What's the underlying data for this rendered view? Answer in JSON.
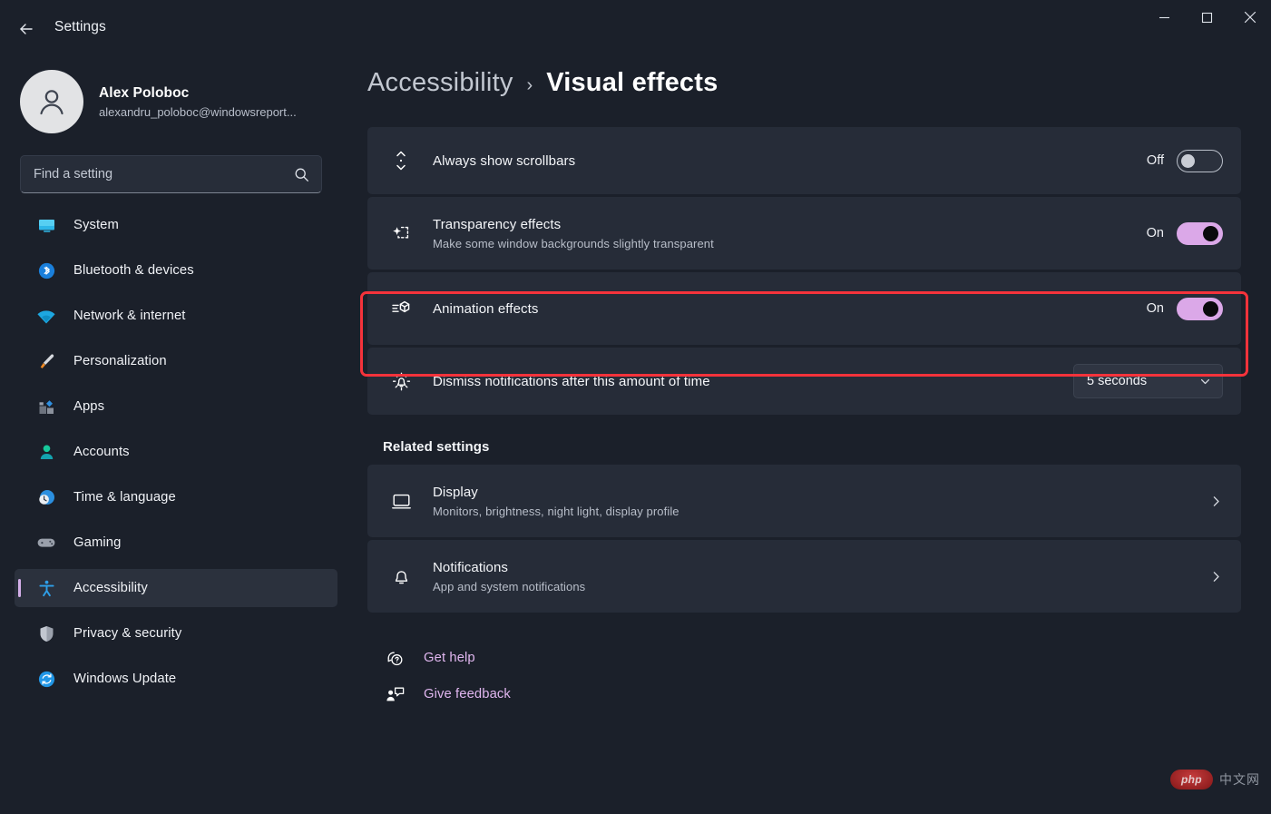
{
  "window": {
    "title": "Settings",
    "back_icon": "arrow-left-icon",
    "controls": {
      "minimize": "minimize-icon",
      "maximize": "maximize-icon",
      "close": "close-icon"
    }
  },
  "account": {
    "name": "Alex Poloboc",
    "email": "alexandru_poloboc@windowsreport...",
    "avatar_icon": "user-avatar-icon"
  },
  "search": {
    "placeholder": "Find a setting",
    "value": "",
    "icon": "search-icon"
  },
  "sidebar": {
    "items": [
      {
        "label": "System",
        "icon": "system-icon",
        "selected": false
      },
      {
        "label": "Bluetooth & devices",
        "icon": "bluetooth-icon",
        "selected": false
      },
      {
        "label": "Network & internet",
        "icon": "wifi-icon",
        "selected": false
      },
      {
        "label": "Personalization",
        "icon": "paintbrush-icon",
        "selected": false
      },
      {
        "label": "Apps",
        "icon": "apps-icon",
        "selected": false
      },
      {
        "label": "Accounts",
        "icon": "accounts-icon",
        "selected": false
      },
      {
        "label": "Time & language",
        "icon": "clock-globe-icon",
        "selected": false
      },
      {
        "label": "Gaming",
        "icon": "gamepad-icon",
        "selected": false
      },
      {
        "label": "Accessibility",
        "icon": "accessibility-person-icon",
        "selected": true
      },
      {
        "label": "Privacy & security",
        "icon": "shield-icon",
        "selected": false
      },
      {
        "label": "Windows Update",
        "icon": "update-refresh-icon",
        "selected": false
      }
    ]
  },
  "breadcrumb": {
    "parent": "Accessibility",
    "separator": "›",
    "current": "Visual effects"
  },
  "settings": {
    "scrollbars": {
      "icon": "scrollbar-vertical-icon",
      "title": "Always show scrollbars",
      "state_label": "Off",
      "state_on": false
    },
    "transparency": {
      "icon": "transparency-sparkle-icon",
      "title": "Transparency effects",
      "subtitle": "Make some window backgrounds slightly transparent",
      "state_label": "On",
      "state_on": true
    },
    "animation": {
      "icon": "animation-motion-icon",
      "title": "Animation effects",
      "state_label": "On",
      "state_on": true,
      "highlighted": true,
      "highlight_color": "#f5333b"
    },
    "dismiss": {
      "icon": "notification-bell-alert-icon",
      "title": "Dismiss notifications after this amount of time",
      "selected_option": "5 seconds",
      "chevron_icon": "chevron-down-icon"
    }
  },
  "related": {
    "heading": "Related settings",
    "items": [
      {
        "icon": "display-monitor-icon",
        "title": "Display",
        "subtitle": "Monitors, brightness, night light, display profile",
        "chevron_icon": "chevron-right-icon"
      },
      {
        "icon": "bell-icon",
        "title": "Notifications",
        "subtitle": "App and system notifications",
        "chevron_icon": "chevron-right-icon"
      }
    ]
  },
  "help_links": [
    {
      "label": "Get help",
      "icon": "help-question-bubble-icon"
    },
    {
      "label": "Give feedback",
      "icon": "feedback-person-bubble-icon"
    }
  ],
  "watermark": {
    "badge": "php",
    "text": "中文网"
  },
  "colors": {
    "page_background": "#1b202a",
    "card_background": "#262c38",
    "accent_pink": "#d3aee8",
    "toggle_on": "#dba8e8",
    "link_text": "#e0b6ef",
    "highlight_red": "#f5333b"
  }
}
